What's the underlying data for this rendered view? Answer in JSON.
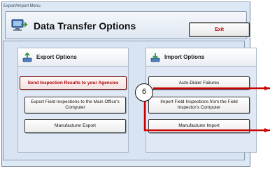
{
  "window": {
    "title": "Export/Import Menu"
  },
  "header": {
    "title": "Data Transfer Options",
    "exit_label": "Exit",
    "icon": "computer-transfer-icon"
  },
  "export": {
    "title": "Export Options",
    "icon": "export-arrow-icon",
    "buttons": [
      "Send Inspection Results to your Agencies",
      "Export Field Inspections to the Main Office's Computer",
      "Manufacturer Export"
    ]
  },
  "import": {
    "title": "Import Options",
    "icon": "import-arrow-icon",
    "buttons": [
      "Auto-Dialer Failures",
      "Import Field Inspections from the Field Inspector's Computer",
      "Manufacturer Import"
    ]
  },
  "annotation": {
    "callout_number": "6",
    "accent_color": "#cc0000"
  },
  "colors": {
    "highlight_text": "#b00000",
    "exit_text": "#b20000"
  }
}
